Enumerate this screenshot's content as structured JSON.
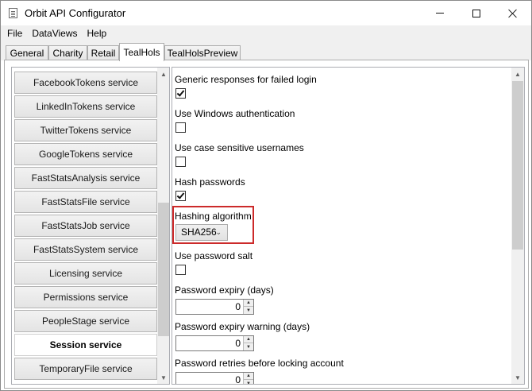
{
  "window": {
    "title": "Orbit API Configurator",
    "icon": "document-icon",
    "controls": {
      "minimize": "minimize-icon",
      "maximize": "maximize-icon",
      "close": "close-icon"
    }
  },
  "menu": {
    "items": [
      {
        "label": "File"
      },
      {
        "label": "DataViews"
      },
      {
        "label": "Help"
      }
    ]
  },
  "tabs": {
    "items": [
      {
        "label": "General"
      },
      {
        "label": "Charity"
      },
      {
        "label": "Retail"
      },
      {
        "label": "TealHols"
      },
      {
        "label": "TealHolsPreview"
      }
    ],
    "active": "TealHols"
  },
  "services": {
    "items": [
      {
        "label": "FacebookTokens service"
      },
      {
        "label": "LinkedInTokens service"
      },
      {
        "label": "TwitterTokens service"
      },
      {
        "label": "GoogleTokens service"
      },
      {
        "label": "FastStatsAnalysis service"
      },
      {
        "label": "FastStatsFile service"
      },
      {
        "label": "FastStatsJob service"
      },
      {
        "label": "FastStatsSystem service"
      },
      {
        "label": "Licensing service"
      },
      {
        "label": "Permissions service"
      },
      {
        "label": "PeopleStage service"
      },
      {
        "label": "Session service"
      },
      {
        "label": "TemporaryFile service"
      }
    ],
    "selected": "Session service"
  },
  "settings": {
    "generic_responses": {
      "label": "Generic responses for failed login",
      "checked": true
    },
    "windows_auth": {
      "label": "Use Windows authentication",
      "checked": false
    },
    "case_sensitive": {
      "label": "Use case sensitive usernames",
      "checked": false
    },
    "hash_passwords": {
      "label": "Hash passwords",
      "checked": true
    },
    "hashing_algorithm": {
      "label": "Hashing algorithm",
      "value": "SHA256",
      "highlight_color": "#cc2a2a"
    },
    "password_salt": {
      "label": "Use password salt",
      "checked": false
    },
    "password_expiry": {
      "label": "Password expiry (days)",
      "value": "0"
    },
    "password_expiry_warning": {
      "label": "Password expiry warning (days)",
      "value": "0"
    },
    "password_retries": {
      "label": "Password retries before locking account",
      "value": "0"
    }
  }
}
